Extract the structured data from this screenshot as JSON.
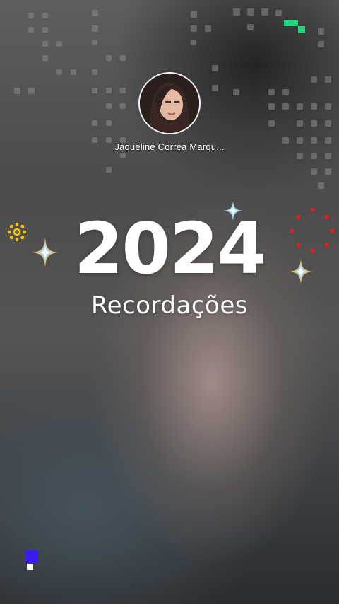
{
  "story": {
    "profile": {
      "avatar_icon": "user-avatar",
      "username": "Jaqueline Correa Marqu..."
    },
    "title": {
      "year": "2024",
      "subtitle": "Recordações"
    },
    "decorations": {
      "sparkle_icon": "four-point-star",
      "sun_icon": "dotted-sun",
      "fireworks_icon": "red-dot-ring",
      "pixel_icons": [
        "green-pixels",
        "blue-pixel-block"
      ]
    },
    "colors": {
      "text": "#ffffff",
      "sparkle": "#9fd6f0",
      "sun": "#f5c400",
      "fireworks": "#e02020",
      "pixel_green": "#1ed37a",
      "pixel_blue": "#3b1cf0"
    }
  }
}
